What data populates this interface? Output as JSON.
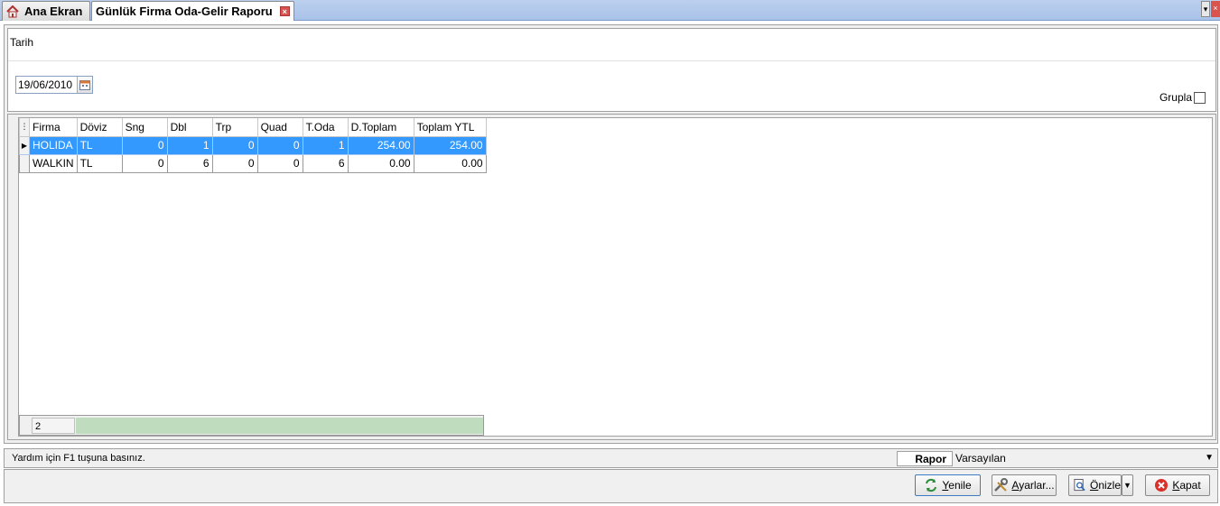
{
  "tabs": [
    {
      "label": "Ana Ekran",
      "icon": "home-icon"
    },
    {
      "label": "Günlük Firma Oda-Gelir Raporu",
      "active": true
    }
  ],
  "filter": {
    "date_label": "Tarih",
    "date_value": "19/06/2010",
    "group_label": "Grupla",
    "group_checked": false
  },
  "grid": {
    "columns": [
      "Firma",
      "Döviz",
      "Sng",
      "Dbl",
      "Trp",
      "Quad",
      "T.Oda",
      "D.Toplam",
      "Toplam YTL"
    ],
    "rows": [
      {
        "firma": "HOLIDA",
        "doviz": "TL",
        "sng": "0",
        "dbl": "1",
        "trp": "0",
        "quad": "0",
        "toda": "1",
        "dtoplam": "254.00",
        "toplam_ytl": "254.00",
        "selected": true
      },
      {
        "firma": "WALKIN",
        "doviz": "TL",
        "sng": "0",
        "dbl": "6",
        "trp": "0",
        "quad": "0",
        "toda": "6",
        "dtoplam": "0.00",
        "toplam_ytl": "0.00",
        "selected": false
      }
    ],
    "row_count": "2",
    "selection_color": "#3399ff",
    "footer_bar_color": "#bfdcbf"
  },
  "status": {
    "help_text": "Yardım için F1 tuşuna basınız.",
    "report_label": "Rapor",
    "report_value": "Varsayılan"
  },
  "buttons": {
    "refresh": {
      "pre": "",
      "u": "Y",
      "post": "enile"
    },
    "settings": {
      "pre": "",
      "u": "A",
      "post": "yarlar..."
    },
    "preview": {
      "pre": "",
      "u": "Ö",
      "post": "nizle"
    },
    "close": {
      "pre": "",
      "u": "K",
      "post": "apat"
    }
  }
}
